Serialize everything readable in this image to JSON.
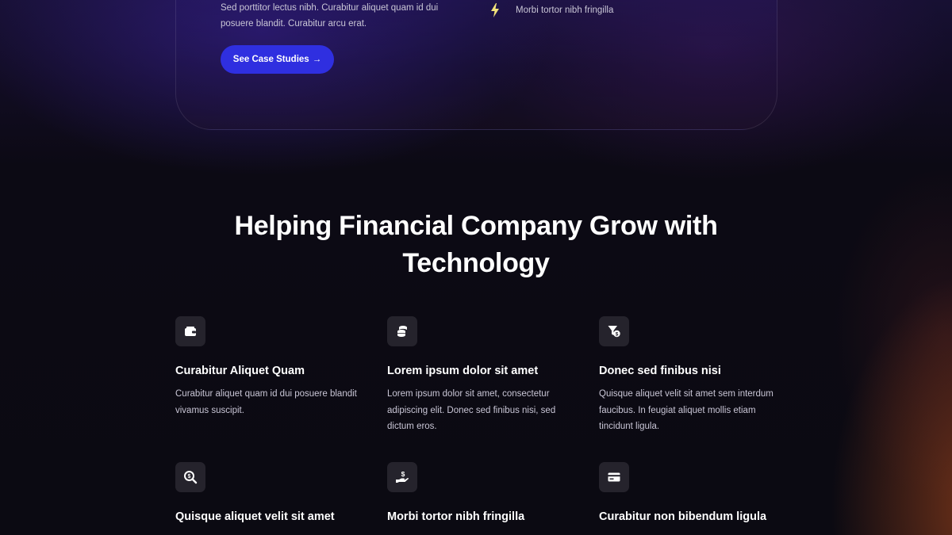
{
  "hero": {
    "text": "Sed porttitor lectus nibh. Curabitur aliquet quam id dui posuere blandit. Curabitur arcu erat.",
    "feature_label": "Morbi tortor nibh fringilla",
    "feature_icon": "bolt-icon",
    "cta_label": "See Case Studies",
    "cta_arrow": "→"
  },
  "section": {
    "title_line1": "Helping Financial Company Grow with",
    "title_line2": "Technology"
  },
  "features": [
    {
      "icon": "wallet-icon",
      "title": "Curabitur Aliquet Quam",
      "desc": "Curabitur aliquet quam id dui posuere blandit vivamus suscipit."
    },
    {
      "icon": "coins-icon",
      "title": "Lorem ipsum dolor sit amet",
      "desc": "Lorem ipsum dolor sit amet, consectetur adipiscing elit. Donec sed finibus nisi, sed dictum eros."
    },
    {
      "icon": "filter-dollar-icon",
      "title": "Donec sed finibus nisi",
      "desc": "Quisque aliquet velit sit amet sem interdum faucibus. In feugiat aliquet mollis etiam tincidunt ligula."
    },
    {
      "icon": "search-dollar-icon",
      "title": "Quisque aliquet velit sit amet",
      "desc": ""
    },
    {
      "icon": "hand-dollar-icon",
      "title": "Morbi tortor nibh fringilla",
      "desc": ""
    },
    {
      "icon": "credit-card-icon",
      "title": "Curabitur non bibendum ligula",
      "desc": ""
    }
  ],
  "colors": {
    "accent": "#2f2fe0",
    "bolt": "#f2e37a",
    "icon_bg": "#25232c"
  }
}
